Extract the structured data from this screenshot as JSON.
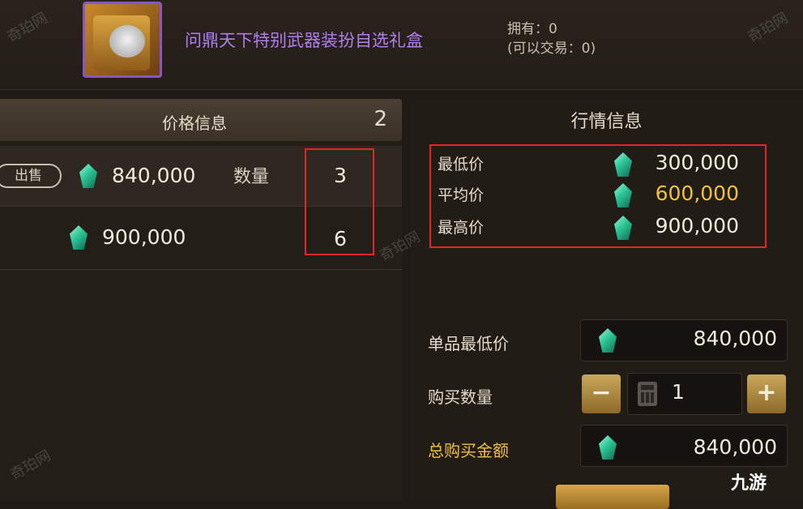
{
  "item": {
    "name": "问鼎天下特别武器装扮自选礼盒",
    "owned": "拥有：0",
    "tradable": "(可以交易：0)"
  },
  "price_info": {
    "title": "价格信息",
    "count": "2",
    "listings": [
      {
        "tag": "出售",
        "price": "840,000",
        "qty_label": "数量",
        "qty": "3"
      },
      {
        "price": "900,000",
        "qty": "6"
      }
    ]
  },
  "market_info": {
    "title": "行情信息",
    "min_label": "最低价",
    "min_value": "300,000",
    "avg_label": "平均价",
    "avg_value": "600,000",
    "max_label": "最高价",
    "max_value": "900,000"
  },
  "purchase": {
    "unit_min_label": "单品最低价",
    "unit_min_value": "840,000",
    "qty_label": "购买数量",
    "qty_value": "1",
    "minus": "−",
    "plus": "+",
    "total_label": "总购买金额",
    "total_value": "840,000"
  },
  "watermarks": {
    "site": "奇珀网",
    "logo": "九游"
  },
  "colors": {
    "accent_gold": "#f0c040",
    "item_purple": "#b07ef0",
    "highlight_red": "#e0282a"
  },
  "icons": [
    "gem-icon",
    "calculator-icon",
    "minus-icon",
    "plus-icon",
    "item-gift-box-icon"
  ]
}
